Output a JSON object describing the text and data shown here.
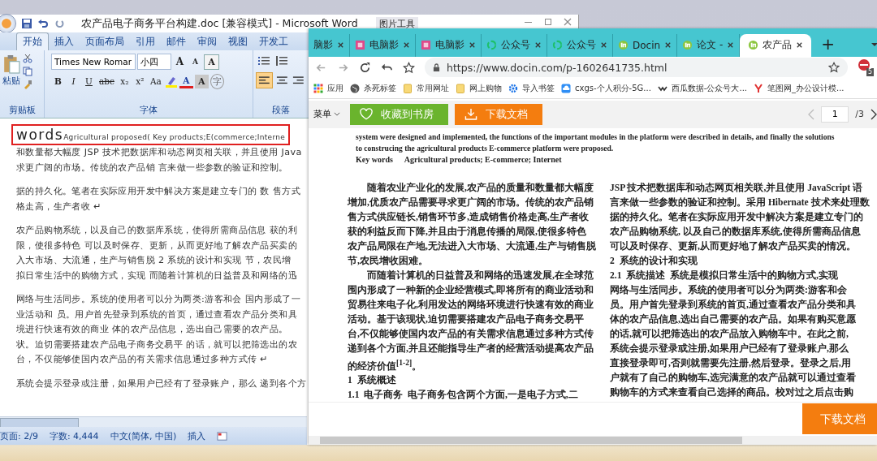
{
  "word": {
    "title": "农产品电子商务平台构建.doc [兼容模式] - Microsoft Word",
    "contextual_tab": "图片工具",
    "tabs": [
      {
        "label": "开始",
        "selected": true
      },
      {
        "label": "插入",
        "selected": false
      },
      {
        "label": "页面布局",
        "selected": false
      },
      {
        "label": "引用",
        "selected": false
      },
      {
        "label": "邮件",
        "selected": false
      },
      {
        "label": "审阅",
        "selected": false
      },
      {
        "label": "视图",
        "selected": false
      },
      {
        "label": "开发工",
        "selected": false
      }
    ],
    "ribbon": {
      "paste_label": "粘贴",
      "font_name": "Times New Romar",
      "font_size": "小四",
      "row1_tools": [
        {
          "label": "A",
          "kind": "grow"
        },
        {
          "label": "A",
          "kind": "shrink"
        },
        {
          "label": "A",
          "kind": "boxed"
        }
      ],
      "row2_tools": [
        {
          "label": "B",
          "kind": "bold"
        },
        {
          "label": "I",
          "kind": "italic"
        },
        {
          "label": "U",
          "kind": "underline"
        },
        {
          "label": "abc",
          "kind": "strike"
        },
        {
          "label": "x₂",
          "kind": "plain"
        },
        {
          "label": "x²",
          "kind": "plain"
        },
        {
          "label": "Aa",
          "kind": "plain"
        },
        {
          "label": "A",
          "kind": "color"
        },
        {
          "label": "A",
          "kind": "shaded"
        },
        {
          "label": "字",
          "kind": "circled"
        }
      ],
      "groups": [
        "剪贴板",
        "字体",
        "段落"
      ]
    },
    "document": {
      "highlight_big": "words",
      "highlight_small": "Agricultural proposed( Key products;E(commerce;Interne",
      "paragraphs": [
        {
          "lines": [
            "和数量都大幅度 JSP 技术把数据库和动态网页相关联，并且使用 Java",
            "求更广阔的市场。传统的农产品销 言来做一些参数的验证和控制。"
          ]
        },
        {
          "lines": [
            "据的持久化。笔者在实际应用开发中解决方案是建立专门的 数 售方式",
            "格走高，生产者收 ↵"
          ]
        },
        {
          "lines": [
            "农产品购物系统，以及自己的数据库系统，使得所需商品信息 获的利",
            "限，使很多特色 可以及时保存、更新，从而更好地了解农产品买卖的",
            "入大市场、大流通，生产与销售脱 2 系统的设计和实现 节，农民增",
            "拟日常生活中的购物方式，实现 而随着计算机的日益普及和网络的迅"
          ]
        },
        {
          "lines": [
            "网络与生活同步。系统的使用者可以分为两类:游客和会 国内形成了一",
            "业活动和 员。用户首先登录到系统的首页，通过查看农产品分类和具",
            "境进行快速有效的商业 体的农产品信息，选出自己需要的农产品。",
            "状。迫切需要搭建农产品电子商务交易平 的话，就可以把筛选出的农",
            "台，不仅能够使国内农产品的有关需求信息通过多种方式传 ↵"
          ]
        },
        {
          "lines": [
            "系统会提示登录或注册，如果用户已经有了登录账户，那么 递到各个方"
          ]
        }
      ]
    },
    "status_bar": [
      "页面: 2/9",
      "字数: 4,444",
      "中文(简体, 中国)",
      "插入"
    ]
  },
  "browser": {
    "tabs": [
      {
        "label": "脑影",
        "kind": "none",
        "selected": false
      },
      {
        "label": "电脑影",
        "kind": "pink",
        "selected": false
      },
      {
        "label": "电脑影",
        "kind": "pink",
        "selected": false
      },
      {
        "label": "公众号",
        "kind": "ring",
        "selected": false
      },
      {
        "label": "公众号",
        "kind": "ring",
        "selected": false
      },
      {
        "label": "Docin",
        "kind": "docin",
        "selected": false
      },
      {
        "label": "论文 -",
        "kind": "docin",
        "selected": false
      },
      {
        "label": "农产品",
        "kind": "docin",
        "selected": true
      }
    ],
    "new_tab": "+",
    "url": "https://www.docin.com/p-1602641735.html",
    "extension_badge": "5",
    "bookmarks": [
      {
        "label": "应用",
        "kind": "apps"
      },
      {
        "label": "杀死标签",
        "kind": "globe"
      },
      {
        "label": "常用网址",
        "kind": "folder"
      },
      {
        "label": "网上购物",
        "kind": "folder"
      },
      {
        "label": "导入书签",
        "kind": "gear"
      },
      {
        "label": "cxgs-个人积分-5G...",
        "kind": "cloud"
      },
      {
        "label": "西瓜数据-公众号大...",
        "kind": "wave"
      },
      {
        "label": "笔图网_办公设计模...",
        "kind": "pin"
      }
    ],
    "toolbar": {
      "menu": "菜单",
      "favorite": "收藏到书房",
      "download": "下载文档",
      "page": "1",
      "total": "/3"
    },
    "document": {
      "abstract_lines": [
        "system were designed and implemented, the functions of the important modules in the platform were described in details, and finally the solutions",
        "to construcing the agricultural products E-commerce platform were proposed."
      ],
      "keywords_label": "Key words",
      "keywords": "Agricultural products; E-commerce; Internet",
      "columns": [
        [
          {
            "kind": "para",
            "indent": true,
            "lines": [
              "随着农业产业化的发展,农产品的质量和数量都大幅度",
              "增加,优质农产品需要寻求更广阔的市场。传统的农产品销",
              "售方式供应链长,销售环节多,造成销售价格走高,生产者收",
              "获的利益反而下降,并且由于消息传播的局限,使很多特色",
              "农产品局限在产地,无法进入大市场、大流通,生产与销售脱",
              "节,农民增收困难。"
            ]
          },
          {
            "kind": "para",
            "indent": true,
            "lines": [
              "而随着计算机的日益普及和网络的迅速发展,在全球范",
              "围内形成了一种新的企业经营模式,即将所有的商业活动和",
              "贸易往来电子化,利用发达的网络环境进行快速有效的商业",
              "活动。基于该现状,迫切需要搭建农产品电子商务交易平",
              "台,不仅能够使国内农产品的有关需求信息通过多种方式传",
              "递到各个方面,并且还能指导生产者的经营活动提高农产品",
              "的经济价值$^{[1-2]}$。"
            ]
          },
          {
            "kind": "heading",
            "lines": [
              "1  系统概述"
            ]
          },
          {
            "kind": "para",
            "indent": false,
            "lines": [
              "**1.1  电子商务**  电子商务包含两个方面,一是电子方式,二"
            ]
          }
        ],
        [
          {
            "kind": "para",
            "indent": false,
            "lines": [
              "JSP 技术把数据库和动态网页相关联,并且使用 JavaScript 语",
              "言来做一些参数的验证和控制。采用 Hibernate 技术来处理数",
              "据的持久化。笔者在实际应用开发中解决方案是建立专门的",
              "农产品购物系统, 以及自己的数据库系统,使得所需商品信息",
              "可以及时保存、更新,从而更好地了解农产品买卖的情况。"
            ]
          },
          {
            "kind": "heading",
            "lines": [
              "2  系统的设计和实现"
            ]
          },
          {
            "kind": "para",
            "indent": false,
            "lines": [
              "**2.1  系统描述**  系统是模拟日常生活中的购物方式,实现",
              "网络与生活同步。系统的使用者可以分为两类:游客和会",
              "员。用户首先登录到系统的首页,通过查看农产品分类和具",
              "体的农产品信息,选出自己需要的农产品。如果有购买意愿",
              "的话,就可以把筛选出的农产品放入购物车中。在此之前,",
              "系统会提示登录或注册,如果用户已经有了登录账户,那么",
              "直接登录即可,否则就需要先注册,然后登录。登录之后,用",
              "户就有了自己的购物车,选完满意的农产品就可以通过查看",
              "购物车的方式来查看自己选择的商品。校对过之后点击购"
            ]
          }
        ]
      ]
    },
    "download_button": "下载文档"
  }
}
